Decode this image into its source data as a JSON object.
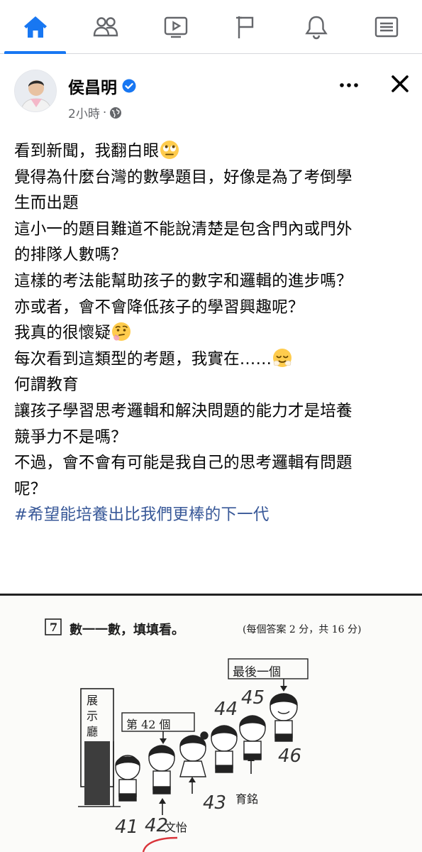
{
  "nav": {
    "tabs": [
      {
        "icon": "home-icon",
        "active": true
      },
      {
        "icon": "friends-icon",
        "active": false
      },
      {
        "icon": "video-icon",
        "active": false
      },
      {
        "icon": "pages-flag-icon",
        "active": false
      },
      {
        "icon": "notifications-bell-icon",
        "active": false
      },
      {
        "icon": "menu-icon",
        "active": false
      }
    ],
    "active_color": "#1877f2"
  },
  "post": {
    "author": "侯昌明",
    "time": "2小時",
    "separator": "·",
    "lines": [
      "看到新聞，我翻白眼",
      "覺得為什麼台灣的數學題目，好像是為了考倒學",
      "生而出題",
      "這小一的題目難道不能說清楚是包含門內或門外",
      "的排隊人數嗎？",
      "這樣的考法能幫助孩子的數字和邏輯的進步嗎？",
      "亦或者，會不會降低孩子的學習興趣呢？",
      "我真的很懷疑",
      "每次看到這類型的考題，我實在……",
      "何謂教育",
      "讓孩子學習思考邏輯和解決問題的能力才是培養",
      "競爭力不是嗎？",
      "不過，會不會有可能是我自己的思考邏輯有問題",
      "呢？"
    ],
    "hashtag": "#希望能培養出比我們更棒的下一代"
  },
  "photo": {
    "question_number": "7",
    "question_text": "數一一數，填填看。",
    "question_score": "(每個答案 2 分，共 16 分)",
    "label_last": "最後一個",
    "label_42nd": "第 42 個",
    "label_hall": "展示廳",
    "label_yuming": "育銘",
    "label_wenyi": "文怡",
    "hand_numbers": [
      "41",
      "42",
      "43",
      "44",
      "45",
      "46"
    ]
  }
}
